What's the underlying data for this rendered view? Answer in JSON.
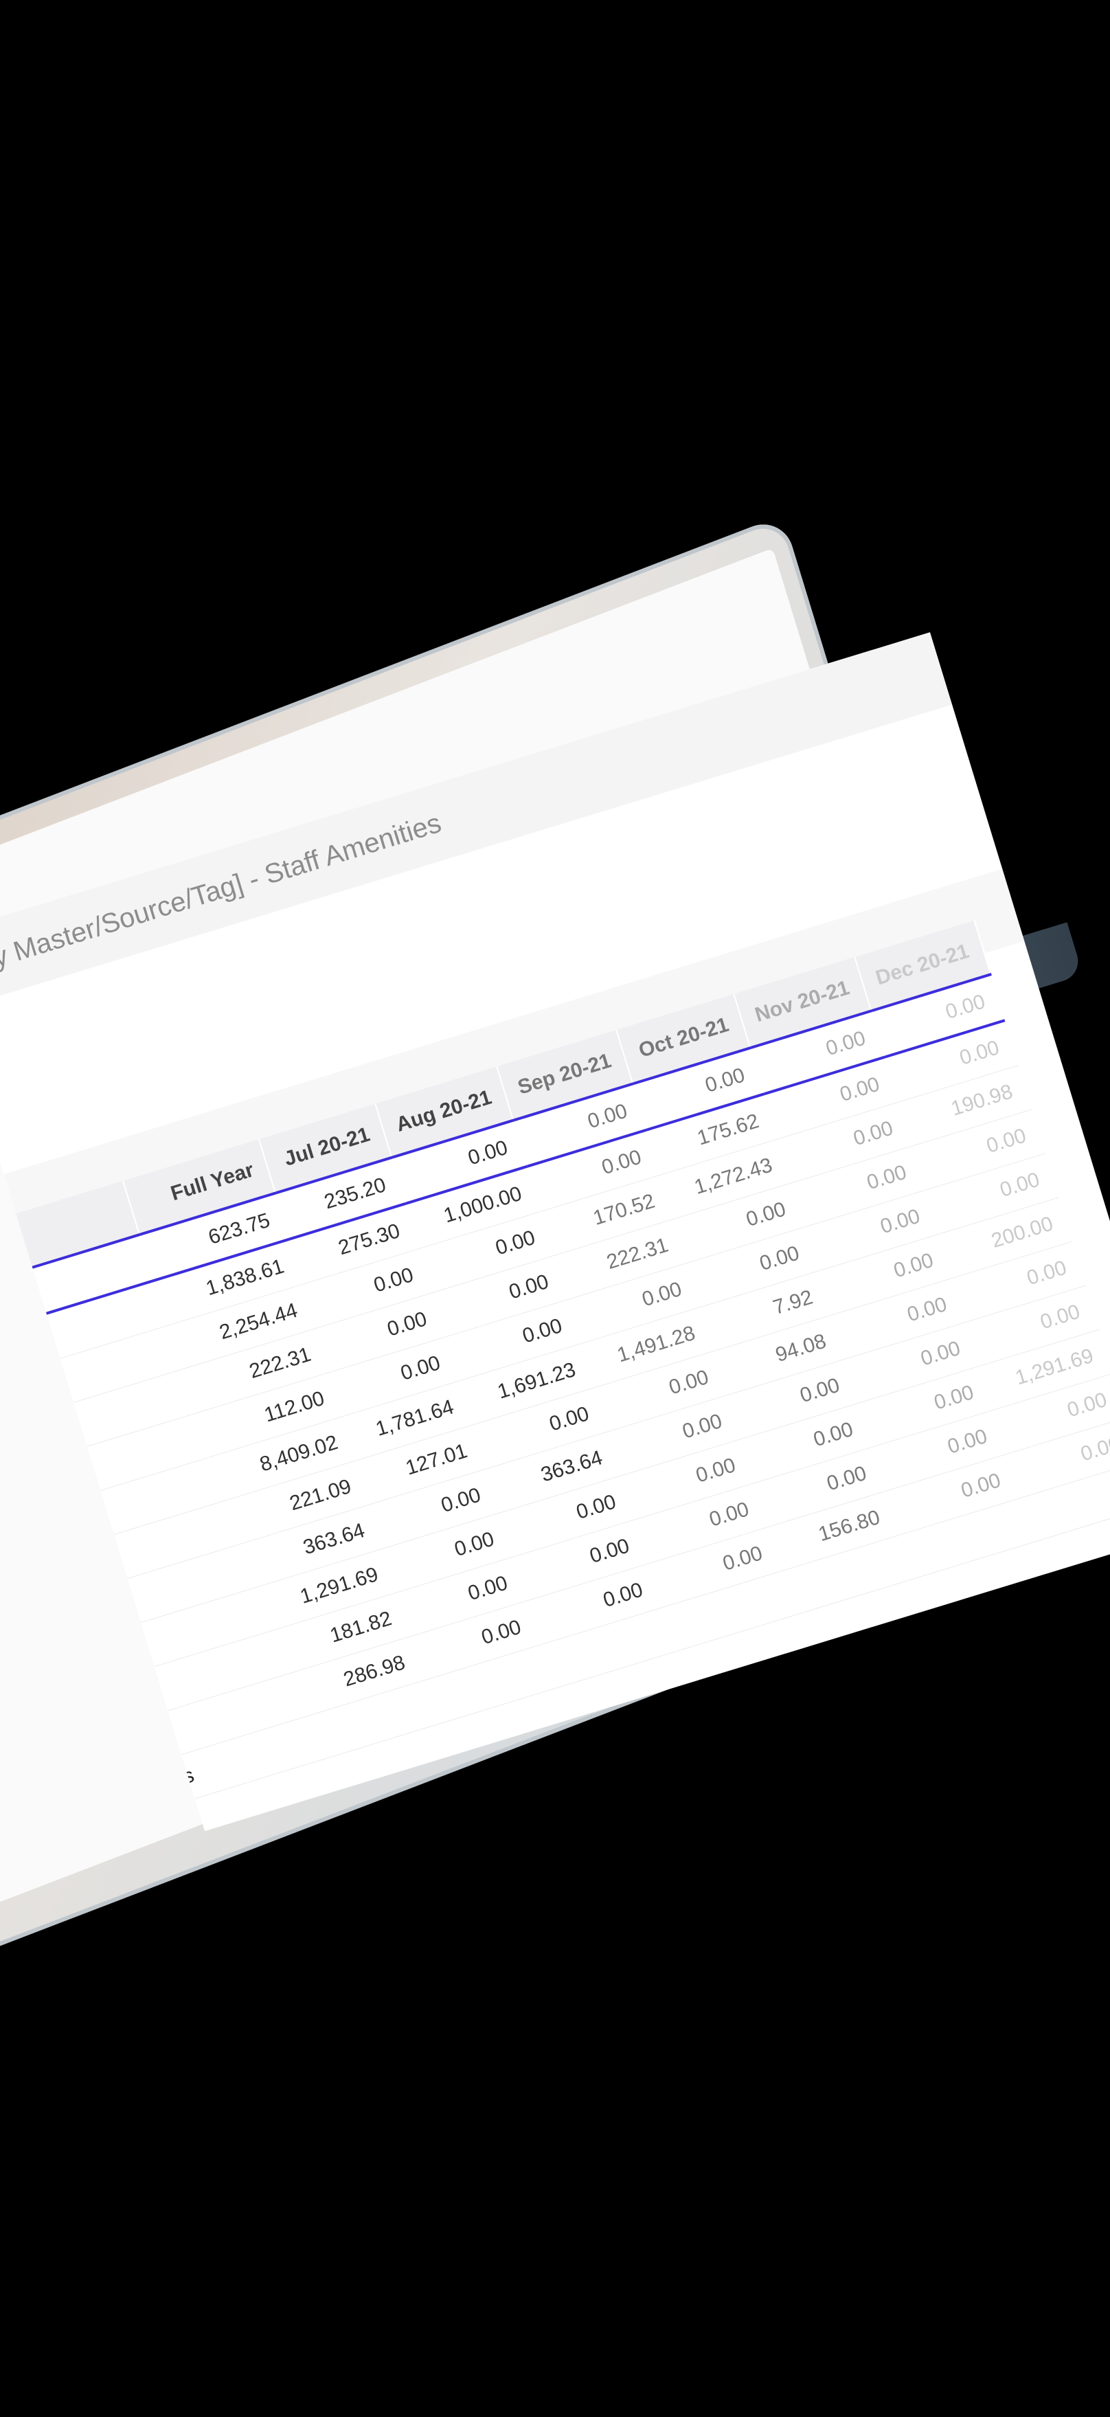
{
  "report": {
    "title": "[By Master/Source/Tag] - Staff Amenities"
  },
  "table": {
    "columns": [
      "",
      "Full Year",
      "Jul 20-21",
      "Aug 20-21",
      "Sep 20-21",
      "Oct 20-21",
      "Nov 20-21",
      "Dec 20-21"
    ],
    "total_row": {
      "label": "",
      "values": [
        "623.75",
        "235.20",
        "0.00",
        "0.00",
        "0.00",
        "0.00",
        "0.00"
      ]
    },
    "rows": [
      {
        "label": "",
        "values": [
          "1,838.61",
          "275.30",
          "1,000.00",
          "0.00",
          "175.62",
          "0.00",
          "0.00"
        ]
      },
      {
        "label": "",
        "values": [
          "2,254.44",
          "0.00",
          "0.00",
          "170.52",
          "1,272.43",
          "0.00",
          "190.98"
        ]
      },
      {
        "label": "",
        "values": [
          "222.31",
          "0.00",
          "0.00",
          "222.31",
          "0.00",
          "0.00",
          "0.00"
        ]
      },
      {
        "label": "",
        "values": [
          "112.00",
          "0.00",
          "0.00",
          "0.00",
          "0.00",
          "0.00",
          "0.00"
        ]
      },
      {
        "label": "",
        "values": [
          "8,409.02",
          "1,781.64",
          "1,691.23",
          "1,491.28",
          "7.92",
          "0.00",
          "200.00"
        ]
      },
      {
        "label": "",
        "values": [
          "221.09",
          "127.01",
          "0.00",
          "0.00",
          "94.08",
          "0.00",
          "0.00"
        ]
      },
      {
        "label": "",
        "values": [
          "363.64",
          "0.00",
          "363.64",
          "0.00",
          "0.00",
          "0.00",
          "0.00"
        ]
      },
      {
        "label": "",
        "values": [
          "1,291.69",
          "0.00",
          "0.00",
          "0.00",
          "0.00",
          "0.00",
          "1,291.69"
        ]
      },
      {
        "label": "",
        "values": [
          "181.82",
          "0.00",
          "0.00",
          "0.00",
          "0.00",
          "0.00",
          "0.00"
        ]
      },
      {
        "label": "",
        "values": [
          "286.98",
          "0.00",
          "0.00",
          "0.00",
          "156.80",
          "0.00",
          "0.00"
        ]
      },
      {
        "label": "hes",
        "values": [
          "",
          "",
          "",
          "",
          "",
          "",
          ""
        ]
      }
    ]
  },
  "colors": {
    "total_border": "#3d2fd9",
    "header_bg": "#ededef",
    "title_bar_bg": "#f2f2f3"
  }
}
